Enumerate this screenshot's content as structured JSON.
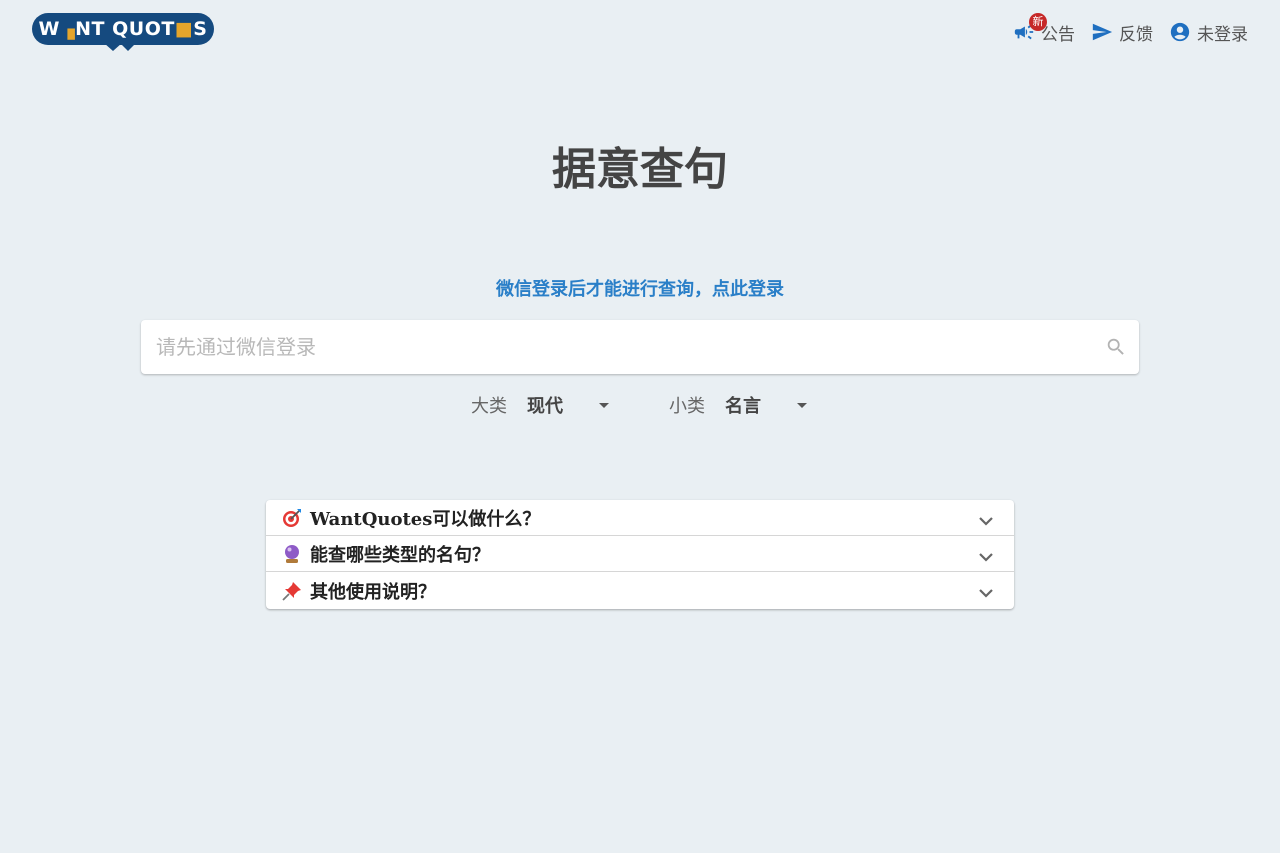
{
  "header": {
    "logo": {
      "text_a": "W",
      "text_b": "NT QUOT",
      "text_c": "S"
    },
    "nav": {
      "announcement_label": "公告",
      "announcement_badge": "新",
      "feedback_label": "反馈",
      "login_label": "未登录"
    }
  },
  "main": {
    "title": "据意查句",
    "login_hint": "微信登录后才能进行查询，点此登录",
    "search": {
      "placeholder": "请先通过微信登录",
      "value": ""
    },
    "filters": {
      "category_label": "大类",
      "category_value": "现代",
      "subcategory_label": "小类",
      "subcategory_value": "名言"
    }
  },
  "faq": {
    "items": [
      {
        "title": "WantQuotes可以做什么？",
        "icon": "target-icon"
      },
      {
        "title": "能查哪些类型的名句？",
        "icon": "crystal-ball-icon"
      },
      {
        "title": "其他使用说明？",
        "icon": "pushpin-icon"
      }
    ]
  },
  "colors": {
    "background": "#e9eff3",
    "brand": "#154a7f",
    "brand_accent": "#e5a52b",
    "link": "#2a7fc8",
    "badge": "#c62828"
  }
}
